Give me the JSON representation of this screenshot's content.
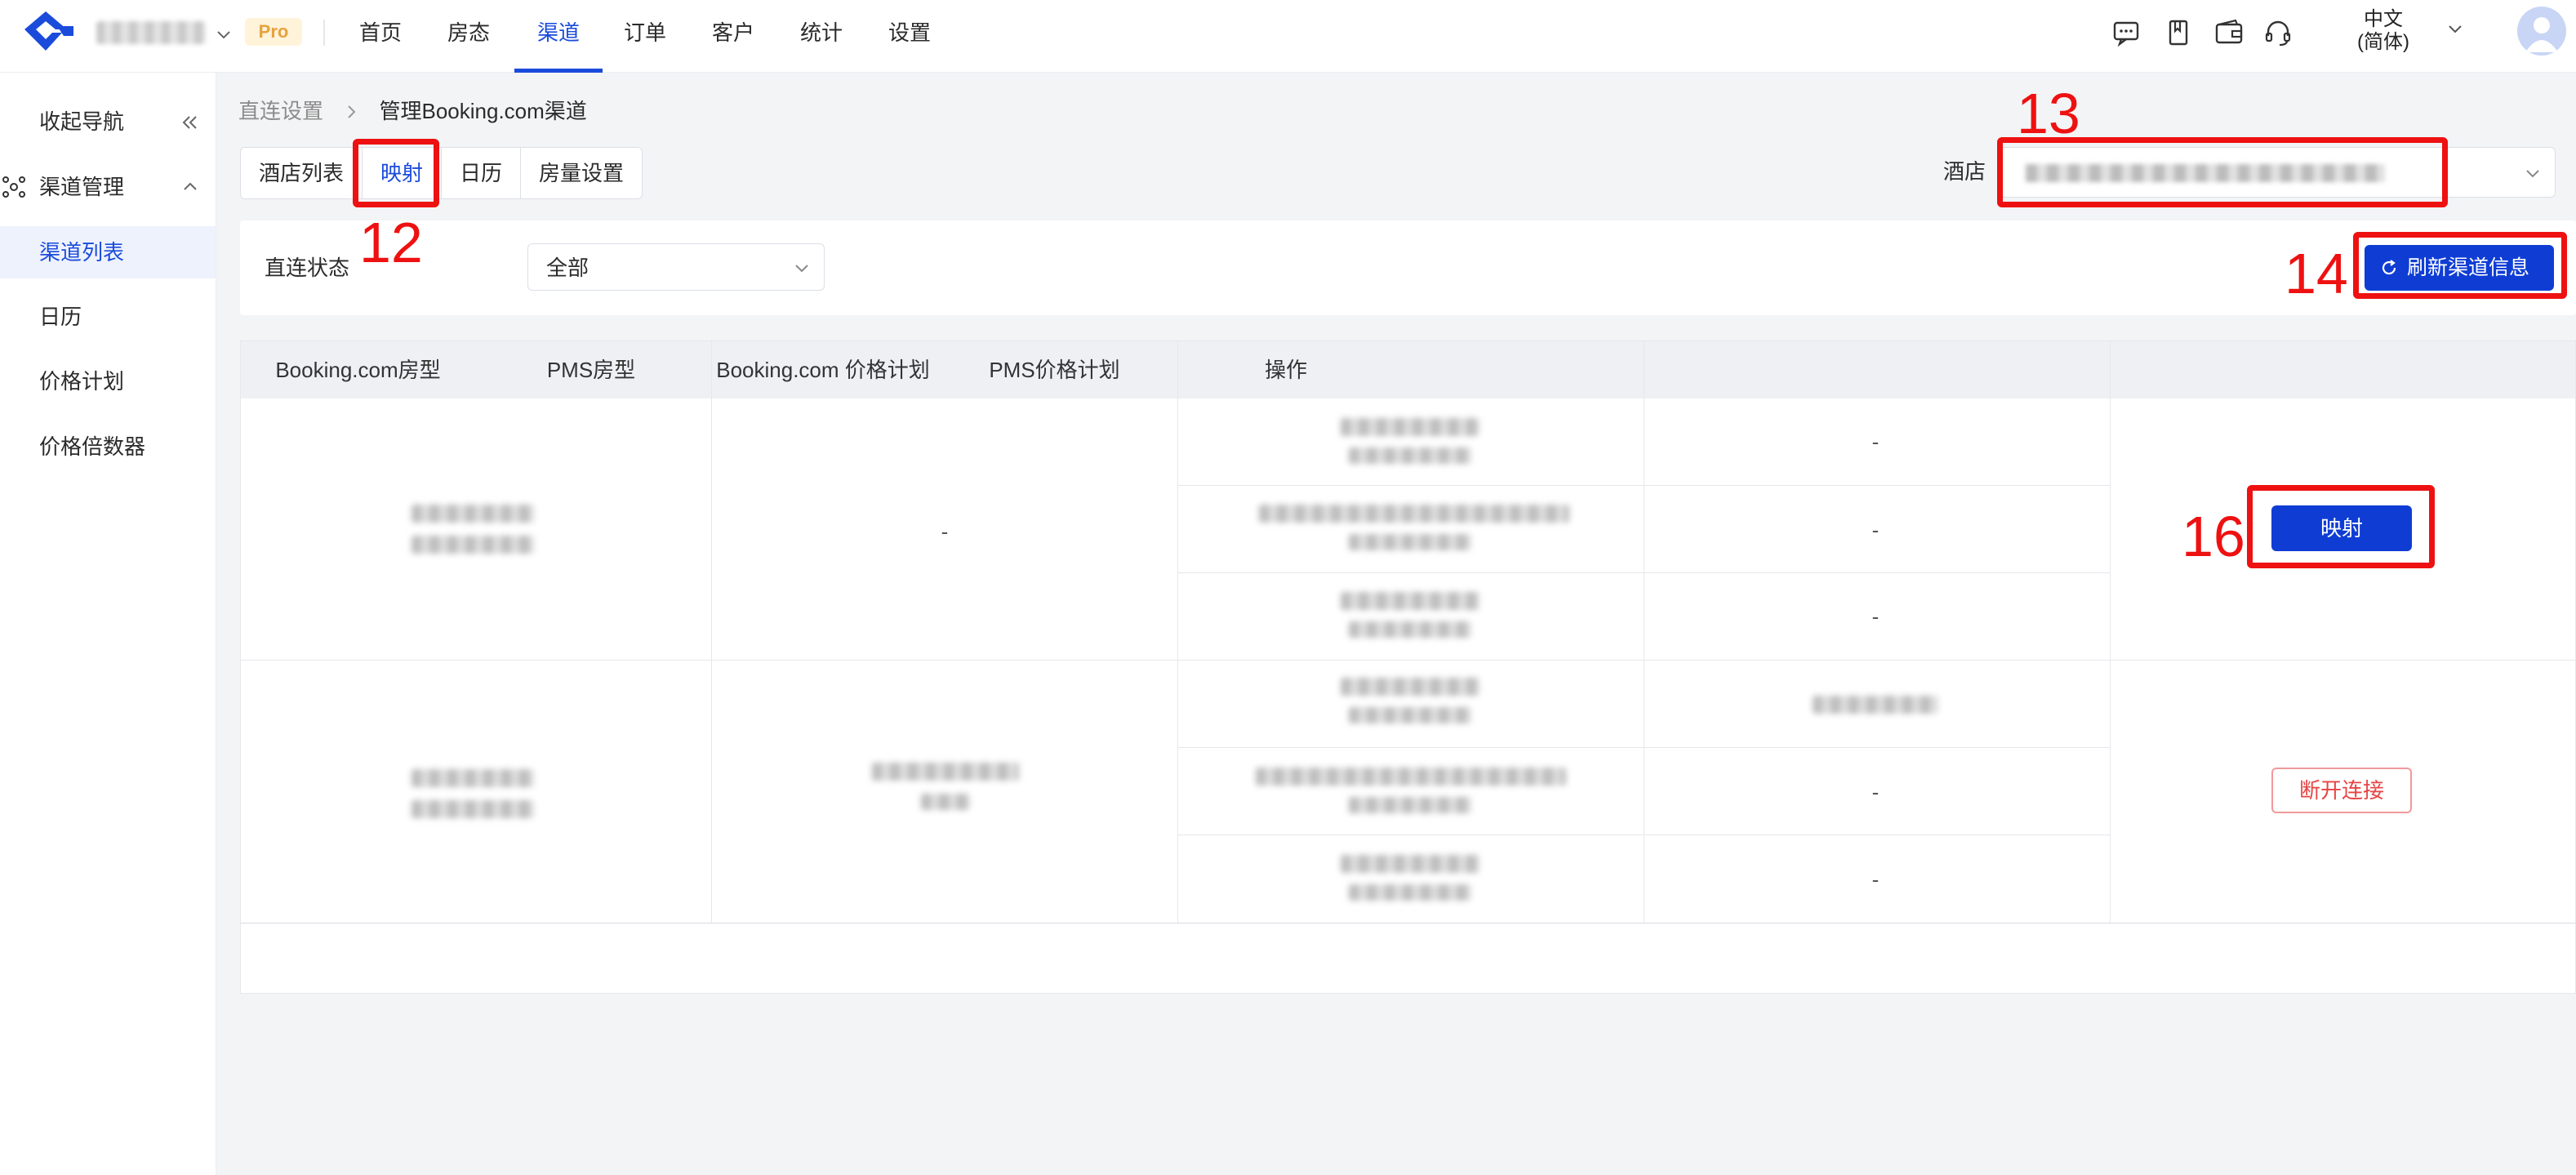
{
  "topbar": {
    "pro_badge": "Pro",
    "nav": [
      "首页",
      "房态",
      "渠道",
      "订单",
      "客户",
      "统计",
      "设置"
    ],
    "active_nav": "渠道",
    "icons": [
      "message-icon",
      "book-icon",
      "wallet-icon",
      "headset-icon"
    ],
    "lang_line1": "中文",
    "lang_line2": "(简体)"
  },
  "sidebar": {
    "collapse_label": "收起导航",
    "group_label": "渠道管理",
    "items": [
      "渠道列表",
      "日历",
      "价格计划",
      "价格倍数器"
    ],
    "active_item": "渠道列表"
  },
  "breadcrumb": {
    "parent": "直连设置",
    "current": "管理Booking.com渠道"
  },
  "tabs": [
    "酒店列表",
    "映射",
    "日历",
    "房量设置"
  ],
  "active_tab": "映射",
  "hotel": {
    "label": "酒店"
  },
  "filter": {
    "status_label": "直连状态",
    "status_value": "全部",
    "refresh_label": "刷新渠道信息"
  },
  "table": {
    "headers": [
      "Booking.com房型",
      "PMS房型",
      "Booking.com 价格计划",
      "PMS价格计划",
      "操作"
    ],
    "rows": [
      {
        "pms_room": "-",
        "plans": [
          {
            "pms_plan": "-"
          },
          {
            "pms_plan": "-"
          },
          {
            "pms_plan": "-"
          }
        ],
        "action": "映射"
      },
      {
        "plans": [
          {
            "pms_plan": ""
          },
          {
            "pms_plan": "-"
          },
          {
            "pms_plan": "-"
          }
        ],
        "action": "断开连接"
      }
    ]
  },
  "annotations": [
    "12",
    "13",
    "14",
    "16"
  ],
  "colors": {
    "primary": "#0f3dd4",
    "nav_active": "#1a4bdb",
    "danger": "#e64545",
    "annotation": "#ee1111",
    "pro_badge": "#e6a23c"
  }
}
